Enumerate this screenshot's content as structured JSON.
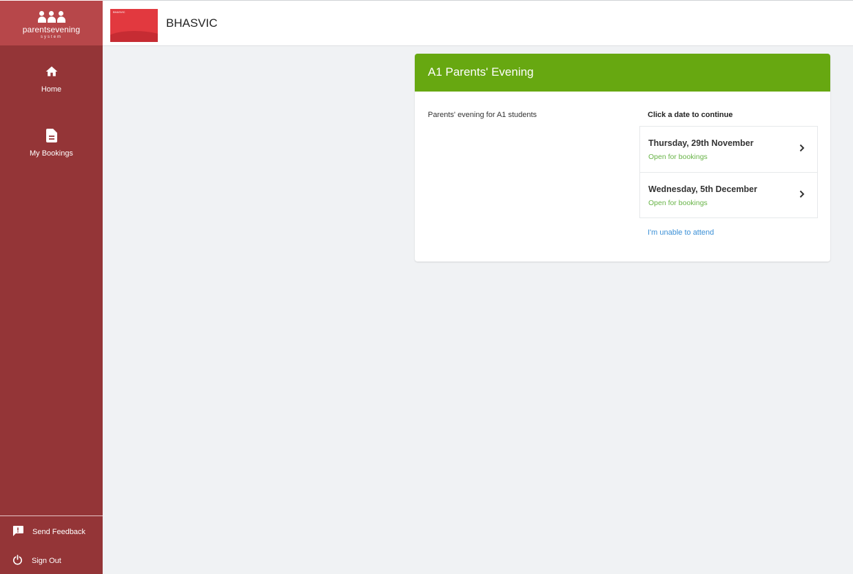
{
  "sidebar": {
    "logo_text": "parentsevening",
    "logo_sub": "system",
    "nav": [
      {
        "label": "Home",
        "icon": "home-icon"
      },
      {
        "label": "My Bookings",
        "icon": "document-icon"
      }
    ],
    "feedback_label": "Send Feedback",
    "signout_label": "Sign Out"
  },
  "header": {
    "school_name": "BHASVIC",
    "logo_tiny_text": "BHASVIC"
  },
  "event": {
    "title": "A1 Parents' Evening",
    "description": "Parents' evening for A1 students",
    "date_prompt": "Click a date to continue",
    "dates": [
      {
        "name": "Thursday, 29th November",
        "status": "Open for bookings"
      },
      {
        "name": "Wednesday, 5th December",
        "status": "Open for bookings"
      }
    ],
    "unable_label": "I'm unable to attend"
  },
  "colors": {
    "sidebar": "#943537",
    "logo_bg": "#b7474a",
    "header_green": "#67a811",
    "status_green": "#67b346",
    "link_blue": "#3a8fd6"
  }
}
